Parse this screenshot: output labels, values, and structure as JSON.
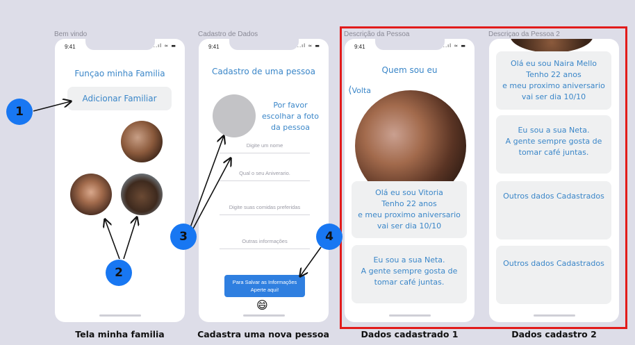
{
  "frames": [
    {
      "label": "Bem vindo",
      "caption": "Tela minha familia"
    },
    {
      "label": "Cadastro de Dados",
      "caption": "Cadastra uma nova pessoa"
    },
    {
      "label": "Descrição da Pessoa",
      "caption": "Dados cadastrado 1"
    },
    {
      "label": "Descriçao da Pessoa 2",
      "caption": "Dados cadastro 2"
    }
  ],
  "status": {
    "time": "9:41",
    "icons": "..ıl ≈ ▬"
  },
  "screen1": {
    "title": "Funçao minha Familia",
    "button": "Adicionar Familiar"
  },
  "screen2": {
    "title": "Cadastro de uma pessoa",
    "photo_prompt_lines": [
      "Por favor",
      "escolhar a foto",
      "da pessoa"
    ],
    "fields": [
      "Digite um nome",
      "Qual  o seu Aniverario.",
      "Digite  suas comidas preferidas",
      "Outras informações"
    ],
    "save_button_lines": [
      "Para Salvar as Informações",
      "Aperte aqui!"
    ],
    "emoji": "😄"
  },
  "screen3": {
    "title": "Quem sou eu",
    "back": "Volta",
    "card1": [
      "Olá eu sou Vitoria",
      "Tenho 22 anos",
      "e meu proximo aniversario",
      "vai ser dia 10/10"
    ],
    "card2": [
      "Eu sou a sua Neta.",
      "A gente sempre gosta de",
      "tomar café juntas."
    ]
  },
  "screen4": {
    "card1": [
      "Olá eu sou Naira Mello",
      "Tenho 22 anos",
      "e meu proximo aniversario",
      "vai ser dia 10/10"
    ],
    "card2": [
      "Eu sou a sua Neta.",
      "A gente sempre gosta de",
      "tomar café juntas."
    ],
    "card3": "Outros dados Cadastrados",
    "card4": "Outros dados Cadastrados"
  },
  "badges": [
    "1",
    "2",
    "3",
    "4"
  ],
  "colors": {
    "accent": "#3a86c8",
    "badge": "#1877f2",
    "highlight": "#e21b1b",
    "background": "#dddde8"
  }
}
